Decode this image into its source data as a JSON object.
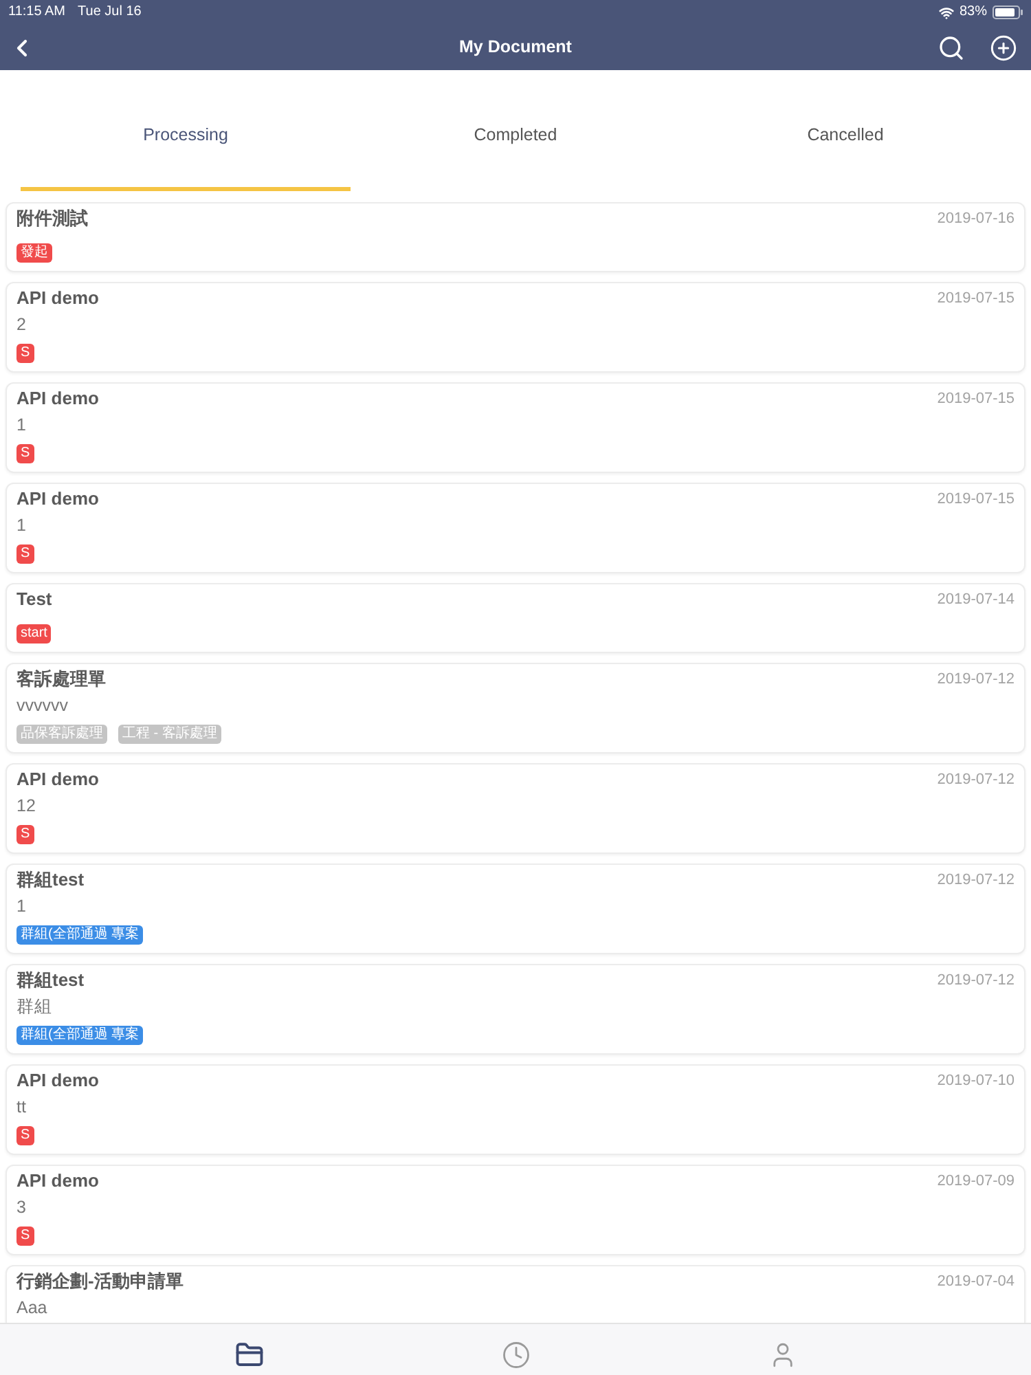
{
  "status_bar": {
    "time": "11:15 AM",
    "date": "Tue Jul 16",
    "battery": "83%"
  },
  "header": {
    "title": "My Document"
  },
  "tabs": [
    {
      "label": "Processing",
      "selected": true
    },
    {
      "label": "Completed",
      "selected": false
    },
    {
      "label": "Cancelled",
      "selected": false
    }
  ],
  "documents": [
    {
      "title": "附件測試",
      "date": "2019-07-16",
      "tags": [
        {
          "label": "發起",
          "color": "#f04b4b"
        }
      ]
    },
    {
      "title": "API demo",
      "subtitle": "2",
      "date": "2019-07-15",
      "tags": [
        {
          "label": "S",
          "color": "#f04b4b"
        }
      ]
    },
    {
      "title": "API demo",
      "subtitle": "1",
      "date": "2019-07-15",
      "tags": [
        {
          "label": "S",
          "color": "#f04b4b"
        }
      ]
    },
    {
      "title": "API demo",
      "subtitle": "1",
      "date": "2019-07-15",
      "tags": [
        {
          "label": "S",
          "color": "#f04b4b"
        }
      ]
    },
    {
      "title": "Test",
      "date": "2019-07-14",
      "tags": [
        {
          "label": "start",
          "color": "#f04b4b"
        }
      ]
    },
    {
      "title": "客訴處理單",
      "subtitle": "vvvvvv",
      "date": "2019-07-12",
      "tags": [
        {
          "label": "品保客訴處理",
          "color": "#c4c4c4"
        },
        {
          "label": "工程 - 客訴處理",
          "color": "#c4c4c4"
        }
      ]
    },
    {
      "title": "API demo",
      "subtitle": "12",
      "date": "2019-07-12",
      "tags": [
        {
          "label": "S",
          "color": "#f04b4b"
        }
      ]
    },
    {
      "title": "群組test",
      "subtitle": "1",
      "date": "2019-07-12",
      "tags": [
        {
          "label": "群組(全部通過 專案",
          "color": "#3b8de6"
        }
      ]
    },
    {
      "title": "群組test",
      "subtitle": "群組",
      "date": "2019-07-12",
      "tags": [
        {
          "label": "群組(全部通過 專案",
          "color": "#3b8de6"
        }
      ]
    },
    {
      "title": "API demo",
      "subtitle": "tt",
      "date": "2019-07-10",
      "tags": [
        {
          "label": "S",
          "color": "#f04b4b"
        }
      ]
    },
    {
      "title": "API demo",
      "subtitle": "3",
      "date": "2019-07-09",
      "tags": [
        {
          "label": "S",
          "color": "#f04b4b"
        }
      ]
    },
    {
      "title": "行銷企劃-活動申請單",
      "subtitle": "Aaa",
      "date": "2019-07-04"
    }
  ],
  "bottom_nav": [
    {
      "selected": true
    },
    {
      "selected": false
    },
    {
      "selected": false
    }
  ]
}
